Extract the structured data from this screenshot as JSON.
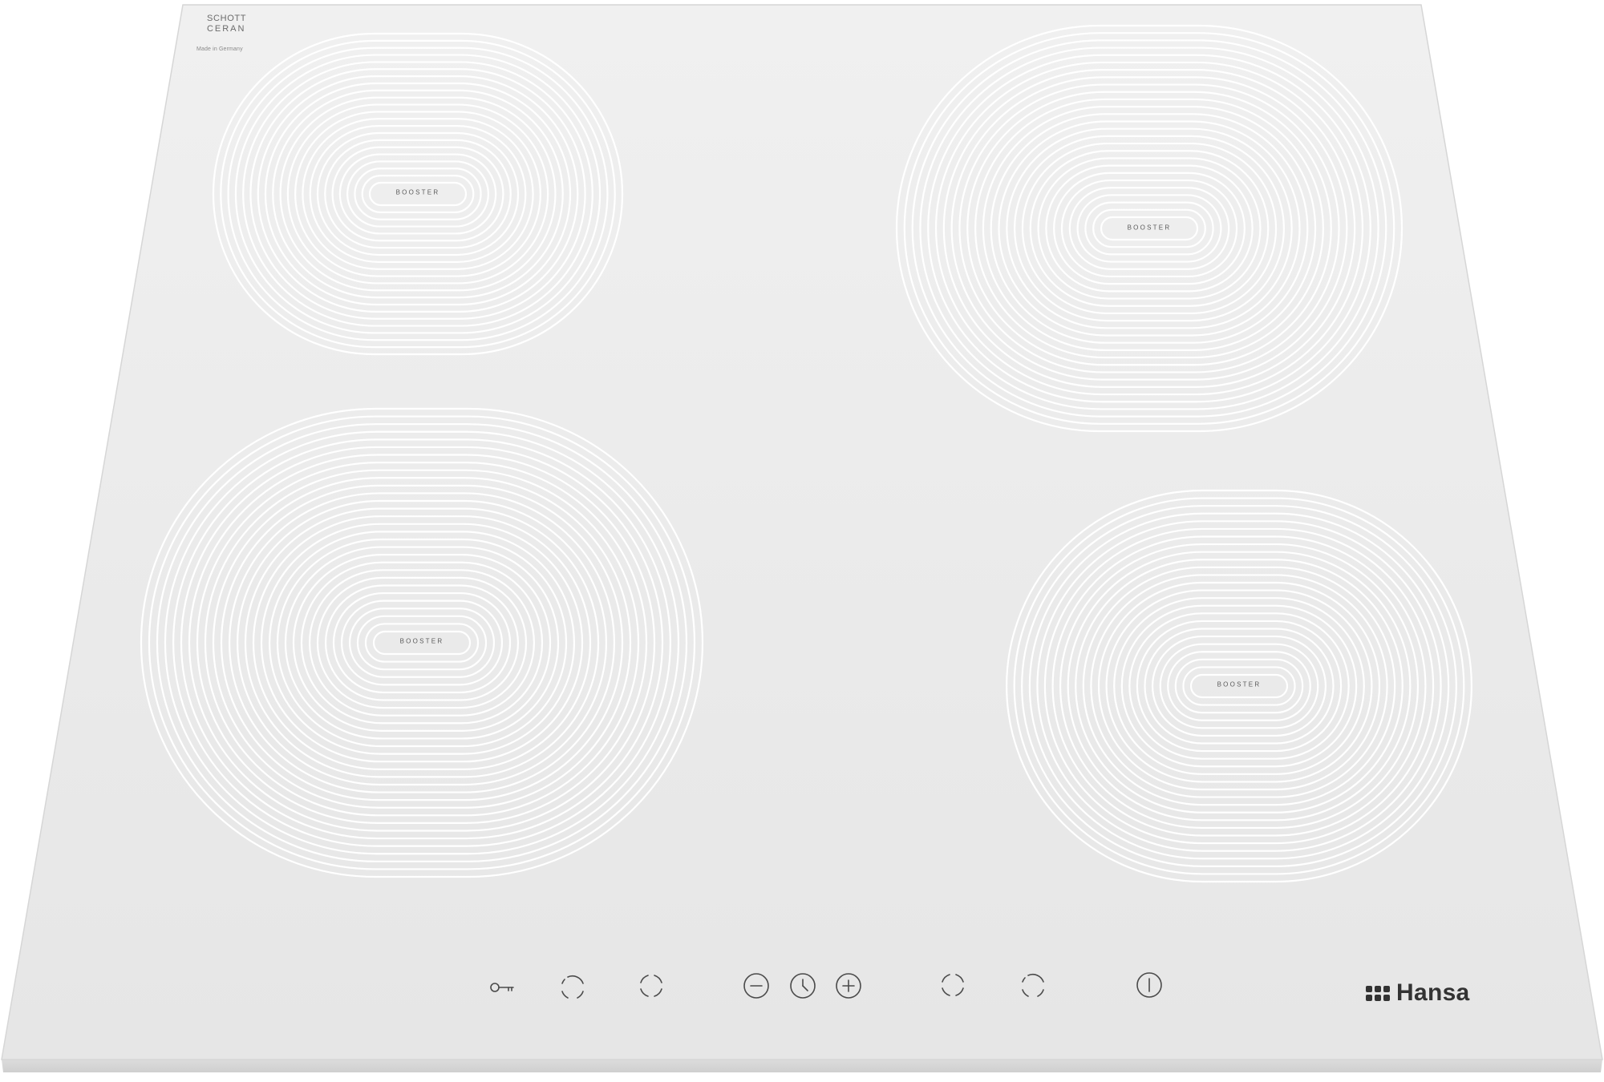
{
  "product": {
    "glass_brand_line1": "SCHOTT",
    "glass_brand_line2": "CERAN",
    "origin_text": "Made in Germany",
    "logo_text": "Hansa"
  },
  "burners": [
    {
      "id": "rear-left",
      "label": "BOOSTER"
    },
    {
      "id": "rear-right",
      "label": "BOOSTER"
    },
    {
      "id": "front-left",
      "label": "BOOSTER"
    },
    {
      "id": "front-right",
      "label": "BOOSTER"
    }
  ],
  "controls": [
    {
      "id": "lock",
      "icon": "key-icon"
    },
    {
      "id": "zone-select-1",
      "icon": "zone-select-icon"
    },
    {
      "id": "zone-select-2",
      "icon": "zone-select-icon"
    },
    {
      "id": "minus",
      "icon": "minus-icon"
    },
    {
      "id": "timer",
      "icon": "clock-icon"
    },
    {
      "id": "plus",
      "icon": "plus-icon"
    },
    {
      "id": "zone-select-3",
      "icon": "zone-select-icon"
    },
    {
      "id": "zone-select-4",
      "icon": "zone-select-icon"
    },
    {
      "id": "power",
      "icon": "power-icon"
    }
  ],
  "colors": {
    "glass": "#eeeeee",
    "glass_edge": "#d8d8d8",
    "zone_lines": "#ffffff",
    "control_symbols": "#4a4a4a",
    "logo": "#333333"
  }
}
